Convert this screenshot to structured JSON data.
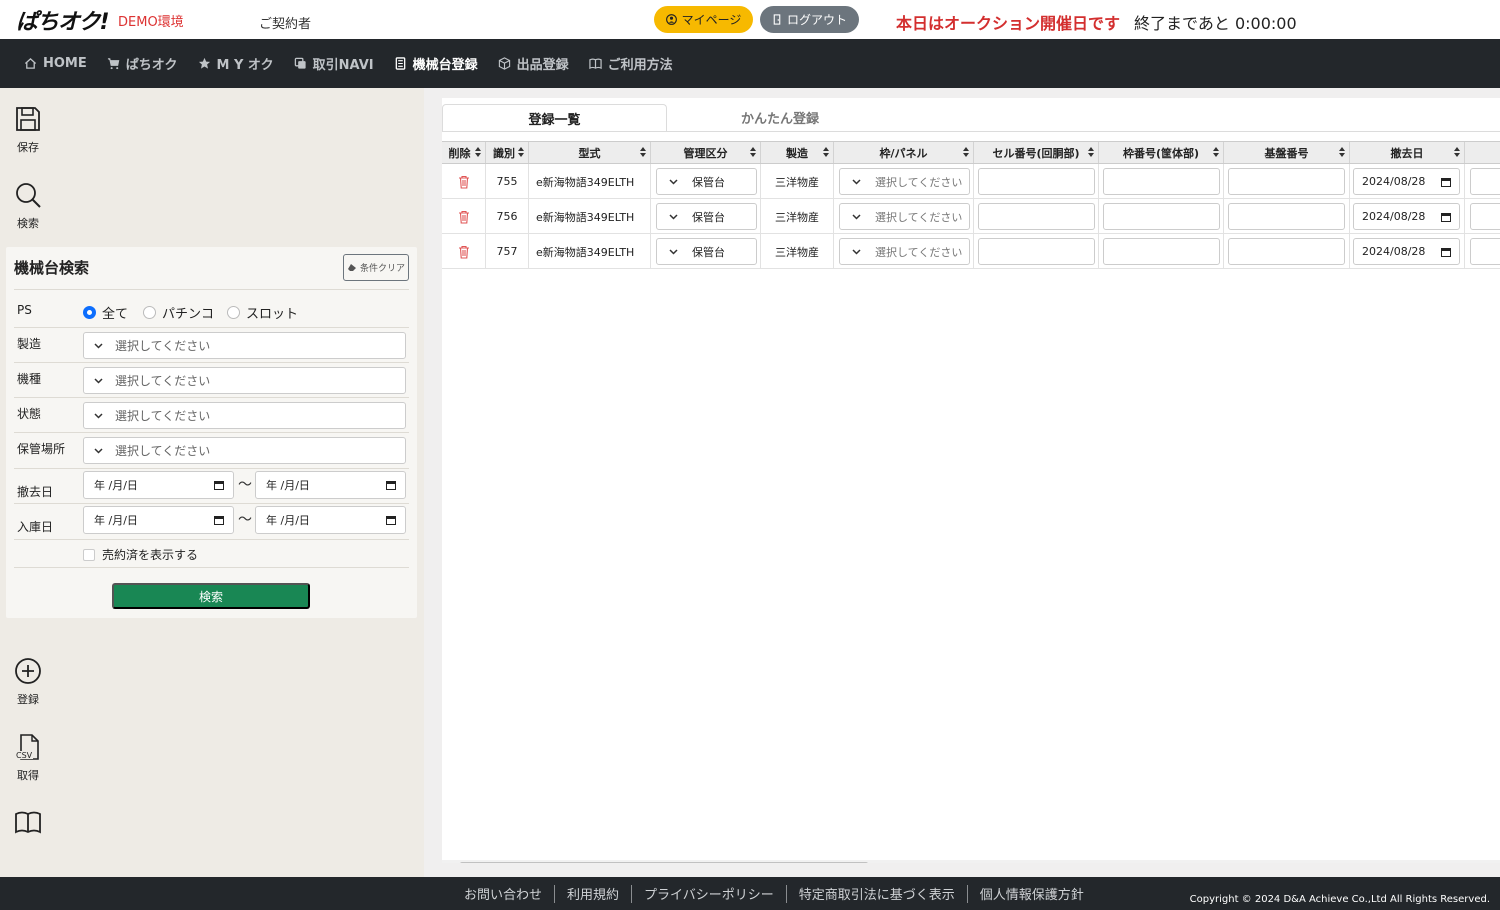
{
  "header": {
    "logo": "ぱちオク!",
    "env_label": "DEMO環境",
    "contract": "ご契約者",
    "mypage_label": "マイページ",
    "logout_label": "ログアウト",
    "auction_message": "本日はオークション開催日です",
    "countdown_label": "終了まであと",
    "countdown_value": "0:00:00"
  },
  "nav": {
    "items": [
      {
        "label": "HOME",
        "icon": "home-icon"
      },
      {
        "label": "ぱちオク",
        "icon": "cart-icon"
      },
      {
        "label": "M Y オク",
        "icon": "star-icon"
      },
      {
        "label": "取引NAVI",
        "icon": "copy-icon"
      },
      {
        "label": "機械台登録",
        "icon": "document-icon"
      },
      {
        "label": "出品登録",
        "icon": "box-icon"
      },
      {
        "label": "ご利用方法",
        "icon": "book-icon"
      }
    ]
  },
  "sidebar": {
    "save_label": "保存",
    "search_label": "検索",
    "register_label": "登録",
    "csv_label": "取得",
    "csv_icon_text": "CSV"
  },
  "search_panel": {
    "title": "機械台検索",
    "clear_label": "条件クリア",
    "ps_label": "PS",
    "ps_options": [
      "全て",
      "パチンコ",
      "スロット"
    ],
    "maker_label": "製造",
    "model_label": "機種",
    "status_label": "状態",
    "storage_label": "保管場所",
    "select_placeholder": "選択してください",
    "removal_label": "撤去日",
    "stock_label": "入庫日",
    "date_placeholder": "年 /月/日",
    "tilde": "〜",
    "sold_label": "売約済を表示する",
    "search_button": "検索"
  },
  "tabs": {
    "list": "登録一覧",
    "easy": "かんたん登録"
  },
  "table": {
    "headers": {
      "delete": "削除",
      "id": "識別",
      "model": "型式",
      "category": "管理区分",
      "maker": "製造",
      "frame": "枠/パネル",
      "cell_no": "セル番号(回胴部)",
      "frame_no": "枠番号(筐体部)",
      "board_no": "基盤番号",
      "removal": "撤去日"
    },
    "rows": [
      {
        "id": "755",
        "model": "e新海物語349ELTH",
        "category": "保管台",
        "maker": "三洋物産",
        "frame": "選択してください",
        "removal": "2024/08/28"
      },
      {
        "id": "756",
        "model": "e新海物語349ELTH",
        "category": "保管台",
        "maker": "三洋物産",
        "frame": "選択してください",
        "removal": "2024/08/28"
      },
      {
        "id": "757",
        "model": "e新海物語349ELTH",
        "category": "保管台",
        "maker": "三洋物産",
        "frame": "選択してください",
        "removal": "2024/08/28"
      }
    ]
  },
  "footer": {
    "links": [
      "お問い合わせ",
      "利用規約",
      "プライバシーポリシー",
      "特定商取引法に基づく表示",
      "個人情報保護方針"
    ],
    "copyright": "Copyright © 2024 D&A Achieve Co.,Ltd All Rights Reserved."
  },
  "colors": {
    "nav_bg": "#23272b",
    "sidebar_bg": "#eeebe5",
    "mypage_btn": "#f7b900",
    "logout_btn": "#6c757d",
    "search_btn": "#198754",
    "alert_red": "#d32f2f",
    "trash_red": "#e05555"
  }
}
